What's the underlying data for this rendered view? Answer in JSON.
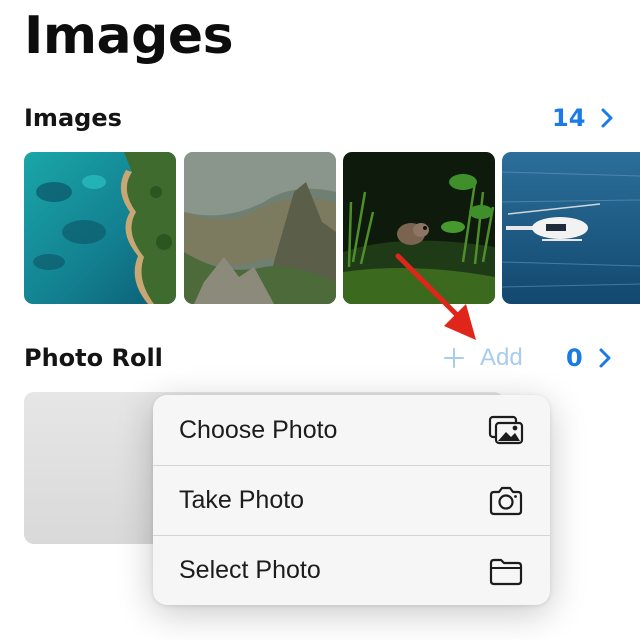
{
  "header": {
    "title": "Images"
  },
  "images_section": {
    "title": "Images",
    "count": "14",
    "thumbnails": [
      {
        "name": "aerial-coast"
      },
      {
        "name": "mountain-valley"
      },
      {
        "name": "rodent-in-grass"
      },
      {
        "name": "helicopter-over-sea"
      }
    ]
  },
  "photo_roll": {
    "title": "Photo Roll",
    "add_label": "Add",
    "count": "0"
  },
  "menu": {
    "items": [
      {
        "label": "Choose Photo",
        "icon": "photo-gallery-icon"
      },
      {
        "label": "Take Photo",
        "icon": "camera-icon"
      },
      {
        "label": "Select Photo",
        "icon": "folder-icon"
      }
    ]
  },
  "colors": {
    "accent": "#1a7ae6",
    "arrow_annotation": "#e0261b"
  }
}
